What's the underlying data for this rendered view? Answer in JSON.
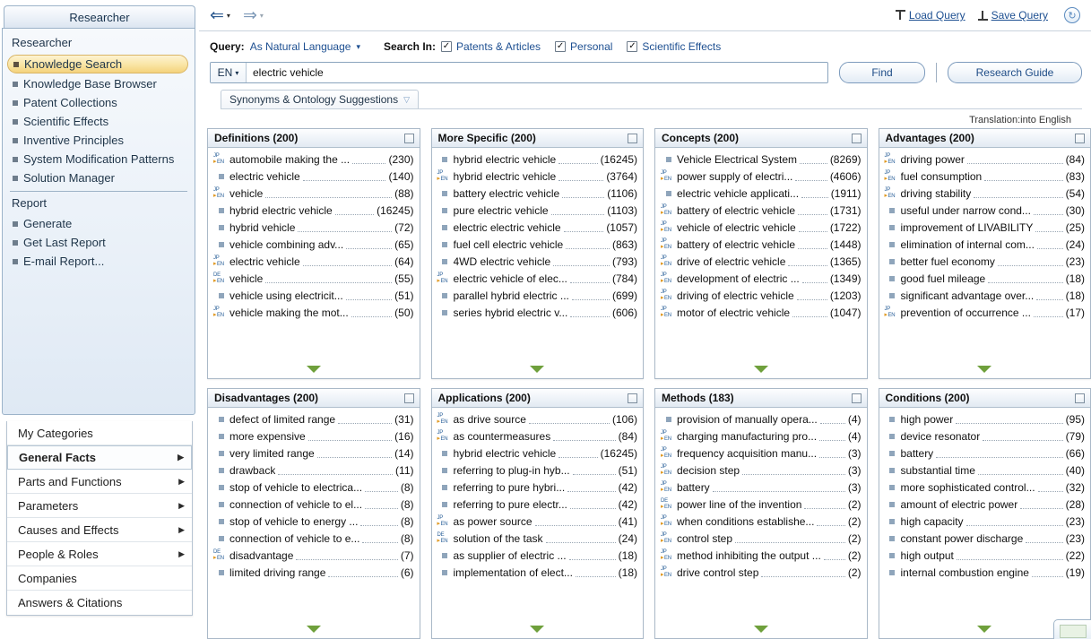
{
  "sidebar": {
    "tab_label": "Researcher",
    "section1_title": "Researcher",
    "items": [
      {
        "label": "Knowledge Search",
        "selected": true
      },
      {
        "label": "Knowledge Base Browser",
        "selected": false
      },
      {
        "label": "Patent Collections",
        "selected": false
      },
      {
        "label": "Scientific Effects",
        "selected": false
      },
      {
        "label": "Inventive Principles",
        "selected": false
      },
      {
        "label": "System Modification Patterns",
        "selected": false
      },
      {
        "label": "Solution Manager",
        "selected": false
      }
    ],
    "section2_title": "Report",
    "report_items": [
      {
        "label": "Generate"
      },
      {
        "label": "Get Last Report"
      },
      {
        "label": "E-mail Report..."
      }
    ],
    "categories": [
      {
        "label": "My Categories",
        "arrow": "",
        "bold": false
      },
      {
        "label": "General Facts",
        "arrow": "▶",
        "bold": true
      },
      {
        "label": "Parts and Functions",
        "arrow": "▶",
        "bold": false
      },
      {
        "label": "Parameters",
        "arrow": "▶",
        "bold": false
      },
      {
        "label": "Causes and Effects",
        "arrow": "▶",
        "bold": false
      },
      {
        "label": "People & Roles",
        "arrow": "▶",
        "bold": false
      },
      {
        "label": "Companies",
        "arrow": "",
        "bold": false
      },
      {
        "label": "Answers & Citations",
        "arrow": "",
        "bold": false
      }
    ]
  },
  "navbar": {
    "back_glyph": "⇐",
    "forward_glyph": "⇒",
    "caret": "▾",
    "load_query": "Load Query",
    "save_query": "Save Query",
    "refresh_glyph": "↻"
  },
  "query": {
    "label": "Query:",
    "mode": "As Natural Language",
    "mode_caret": "▾",
    "search_in_label": "Search In:",
    "checks": [
      {
        "label": "Patents & Articles",
        "checked": true
      },
      {
        "label": "Personal",
        "checked": true
      },
      {
        "label": "Scientific Effects",
        "checked": true
      }
    ],
    "lang": "EN",
    "lang_caret": "▾",
    "input_value": "electric vehicle",
    "input_placeholder": "",
    "find_button": "Find",
    "research_guide_button": "Research Guide",
    "synonyms_tab": "Synonyms & Ontology Suggestions",
    "synonyms_caret": "▽",
    "translation_note": "Translation:into English"
  },
  "panels": [
    {
      "title": "Definitions (200)",
      "rows": [
        {
          "icon": "jp-en",
          "label": "automobile making the ...",
          "count": "(230)"
        },
        {
          "icon": "square",
          "label": "electric vehicle",
          "count": "(140)"
        },
        {
          "icon": "jp-en",
          "label": "vehicle",
          "count": "(88)"
        },
        {
          "icon": "square",
          "label": "hybrid electric vehicle",
          "count": "(16245)"
        },
        {
          "icon": "square",
          "label": "hybrid vehicle",
          "count": "(72)"
        },
        {
          "icon": "square",
          "label": "vehicle combining adv...",
          "count": "(65)"
        },
        {
          "icon": "jp-en",
          "label": "electric vehicle",
          "count": "(64)"
        },
        {
          "icon": "de-en",
          "label": "vehicle",
          "count": "(55)"
        },
        {
          "icon": "square",
          "label": "vehicle using electricit...",
          "count": "(51)"
        },
        {
          "icon": "jp-en",
          "label": "vehicle making the mot...",
          "count": "(50)"
        }
      ]
    },
    {
      "title": "More Specific (200)",
      "rows": [
        {
          "icon": "square",
          "label": "hybrid electric vehicle",
          "count": "(16245)"
        },
        {
          "icon": "jp-en",
          "label": "hybrid electric vehicle",
          "count": "(3764)"
        },
        {
          "icon": "square",
          "label": "battery electric vehicle",
          "count": "(1106)"
        },
        {
          "icon": "square",
          "label": "pure electric vehicle",
          "count": "(1103)"
        },
        {
          "icon": "square",
          "label": "electric electric vehicle",
          "count": "(1057)"
        },
        {
          "icon": "square",
          "label": "fuel cell electric vehicle",
          "count": "(863)"
        },
        {
          "icon": "square",
          "label": "4WD electric vehicle",
          "count": "(793)"
        },
        {
          "icon": "jp-en",
          "label": "electric vehicle of elec...",
          "count": "(784)"
        },
        {
          "icon": "square",
          "label": "parallel hybrid electric ...",
          "count": "(699)"
        },
        {
          "icon": "square",
          "label": "series hybrid electric v...",
          "count": "(606)"
        }
      ]
    },
    {
      "title": "Concepts (200)",
      "rows": [
        {
          "icon": "square",
          "label": "Vehicle Electrical System",
          "count": "(8269)"
        },
        {
          "icon": "jp-en",
          "label": "power supply of electri...",
          "count": "(4606)"
        },
        {
          "icon": "square",
          "label": "electric vehicle applicati...",
          "count": "(1911)"
        },
        {
          "icon": "jp-en",
          "label": "battery of electric vehicle",
          "count": "(1731)"
        },
        {
          "icon": "jp-en",
          "label": "vehicle of electric vehicle",
          "count": "(1722)"
        },
        {
          "icon": "jp-en",
          "label": "battery of electric vehicle",
          "count": "(1448)"
        },
        {
          "icon": "jp-en",
          "label": "drive of electric vehicle",
          "count": "(1365)"
        },
        {
          "icon": "jp-en",
          "label": "development of electric ...",
          "count": "(1349)"
        },
        {
          "icon": "jp-en",
          "label": "driving of electric vehicle",
          "count": "(1203)"
        },
        {
          "icon": "jp-en",
          "label": "motor of electric vehicle",
          "count": "(1047)"
        }
      ]
    },
    {
      "title": "Advantages (200)",
      "rows": [
        {
          "icon": "jp-en",
          "label": "driving power",
          "count": "(84)"
        },
        {
          "icon": "jp-en",
          "label": "fuel consumption",
          "count": "(83)"
        },
        {
          "icon": "jp-en",
          "label": "driving stability",
          "count": "(54)"
        },
        {
          "icon": "square",
          "label": "useful under narrow cond...",
          "count": "(30)"
        },
        {
          "icon": "square",
          "label": "improvement of LIVABILITY",
          "count": "(25)"
        },
        {
          "icon": "square",
          "label": "elimination of internal com...",
          "count": "(24)"
        },
        {
          "icon": "square",
          "label": "better fuel economy",
          "count": "(23)"
        },
        {
          "icon": "square",
          "label": "good fuel mileage",
          "count": "(18)"
        },
        {
          "icon": "square",
          "label": "significant advantage over...",
          "count": "(18)"
        },
        {
          "icon": "jp-en",
          "label": "prevention of occurrence ...",
          "count": "(17)"
        }
      ]
    },
    {
      "title": "Disadvantages (200)",
      "rows": [
        {
          "icon": "square",
          "label": "defect of limited range",
          "count": "(31)"
        },
        {
          "icon": "square",
          "label": "more expensive",
          "count": "(16)"
        },
        {
          "icon": "square",
          "label": "very limited range",
          "count": "(14)"
        },
        {
          "icon": "square",
          "label": "drawback",
          "count": "(11)"
        },
        {
          "icon": "square",
          "label": "stop of vehicle to electrica...",
          "count": "(8)"
        },
        {
          "icon": "square",
          "label": "connection of vehicle to el...",
          "count": "(8)"
        },
        {
          "icon": "square",
          "label": "stop of vehicle to energy ...",
          "count": "(8)"
        },
        {
          "icon": "square",
          "label": "connection of vehicle to e...",
          "count": "(8)"
        },
        {
          "icon": "de-en",
          "label": "disadvantage",
          "count": "(7)"
        },
        {
          "icon": "square",
          "label": "limited driving range",
          "count": "(6)"
        }
      ]
    },
    {
      "title": "Applications (200)",
      "rows": [
        {
          "icon": "jp-en",
          "label": "as drive source",
          "count": "(106)"
        },
        {
          "icon": "jp-en",
          "label": "as countermeasures",
          "count": "(84)"
        },
        {
          "icon": "square",
          "label": "hybrid electric vehicle",
          "count": "(16245)"
        },
        {
          "icon": "square",
          "label": "referring to plug-in hyb...",
          "count": "(51)"
        },
        {
          "icon": "square",
          "label": "referring to pure hybri...",
          "count": "(42)"
        },
        {
          "icon": "square",
          "label": "referring to pure electr...",
          "count": "(42)"
        },
        {
          "icon": "jp-en",
          "label": "as power source",
          "count": "(41)"
        },
        {
          "icon": "de-en",
          "label": "solution of the task",
          "count": "(24)"
        },
        {
          "icon": "square",
          "label": "as supplier of electric ...",
          "count": "(18)"
        },
        {
          "icon": "square",
          "label": "implementation of elect...",
          "count": "(18)"
        }
      ]
    },
    {
      "title": "Methods (183)",
      "rows": [
        {
          "icon": "square",
          "label": "provision of manually opera...",
          "count": "(4)"
        },
        {
          "icon": "jp-en",
          "label": "charging manufacturing pro...",
          "count": "(4)"
        },
        {
          "icon": "jp-en",
          "label": "frequency acquisition manu...",
          "count": "(3)"
        },
        {
          "icon": "jp-en",
          "label": "decision step",
          "count": "(3)"
        },
        {
          "icon": "jp-en",
          "label": "battery",
          "count": "(3)"
        },
        {
          "icon": "de-en",
          "label": "power line of the invention",
          "count": "(2)"
        },
        {
          "icon": "jp-en",
          "label": "when conditions establishe...",
          "count": "(2)"
        },
        {
          "icon": "jp-en",
          "label": "control step",
          "count": "(2)"
        },
        {
          "icon": "jp-en",
          "label": "method inhibiting the output ...",
          "count": "(2)"
        },
        {
          "icon": "jp-en",
          "label": "drive control step",
          "count": "(2)"
        }
      ]
    },
    {
      "title": "Conditions (200)",
      "rows": [
        {
          "icon": "square",
          "label": "high power",
          "count": "(95)"
        },
        {
          "icon": "square",
          "label": "device resonator",
          "count": "(79)"
        },
        {
          "icon": "square",
          "label": "battery",
          "count": "(66)"
        },
        {
          "icon": "square",
          "label": "substantial time",
          "count": "(40)"
        },
        {
          "icon": "square",
          "label": "more sophisticated control...",
          "count": "(32)"
        },
        {
          "icon": "square",
          "label": "amount of electric power",
          "count": "(28)"
        },
        {
          "icon": "square",
          "label": "high capacity",
          "count": "(23)"
        },
        {
          "icon": "square",
          "label": "constant power discharge",
          "count": "(23)"
        },
        {
          "icon": "square",
          "label": "high output",
          "count": "(22)"
        },
        {
          "icon": "square",
          "label": "internal combustion engine",
          "count": "(19)"
        }
      ]
    }
  ],
  "icons": {
    "jp": "JP",
    "de": "DE",
    "en": "EN",
    "arrow": "▸",
    "expand_more": "expand-more-arrow"
  },
  "colors": {
    "accent_link": "#1d4f91",
    "selected_item": "#f4d27c",
    "panel_border": "#aab9c8",
    "bullet": "#8fa5bb",
    "green_arrow": "#6fa03c",
    "translation_icon": "#2a6099",
    "translation_arrow": "#e09820"
  }
}
